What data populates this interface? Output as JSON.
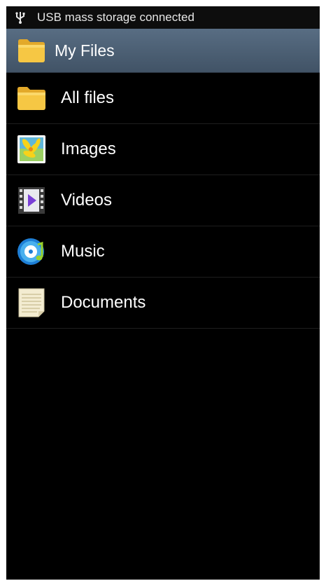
{
  "status_bar": {
    "icon": "usb-icon",
    "text": "USB mass storage connected"
  },
  "action_bar": {
    "icon": "folder-icon",
    "title": "My Files"
  },
  "items": [
    {
      "label": "All files",
      "icon": "folder-icon"
    },
    {
      "label": "Images",
      "icon": "image-icon"
    },
    {
      "label": "Videos",
      "icon": "video-icon"
    },
    {
      "label": "Music",
      "icon": "music-icon"
    },
    {
      "label": "Documents",
      "icon": "document-icon"
    }
  ],
  "colors": {
    "background": "#000000",
    "action_bar": "#4d5f73",
    "folder": "#f6c744",
    "divider": "#1e1e1e"
  }
}
